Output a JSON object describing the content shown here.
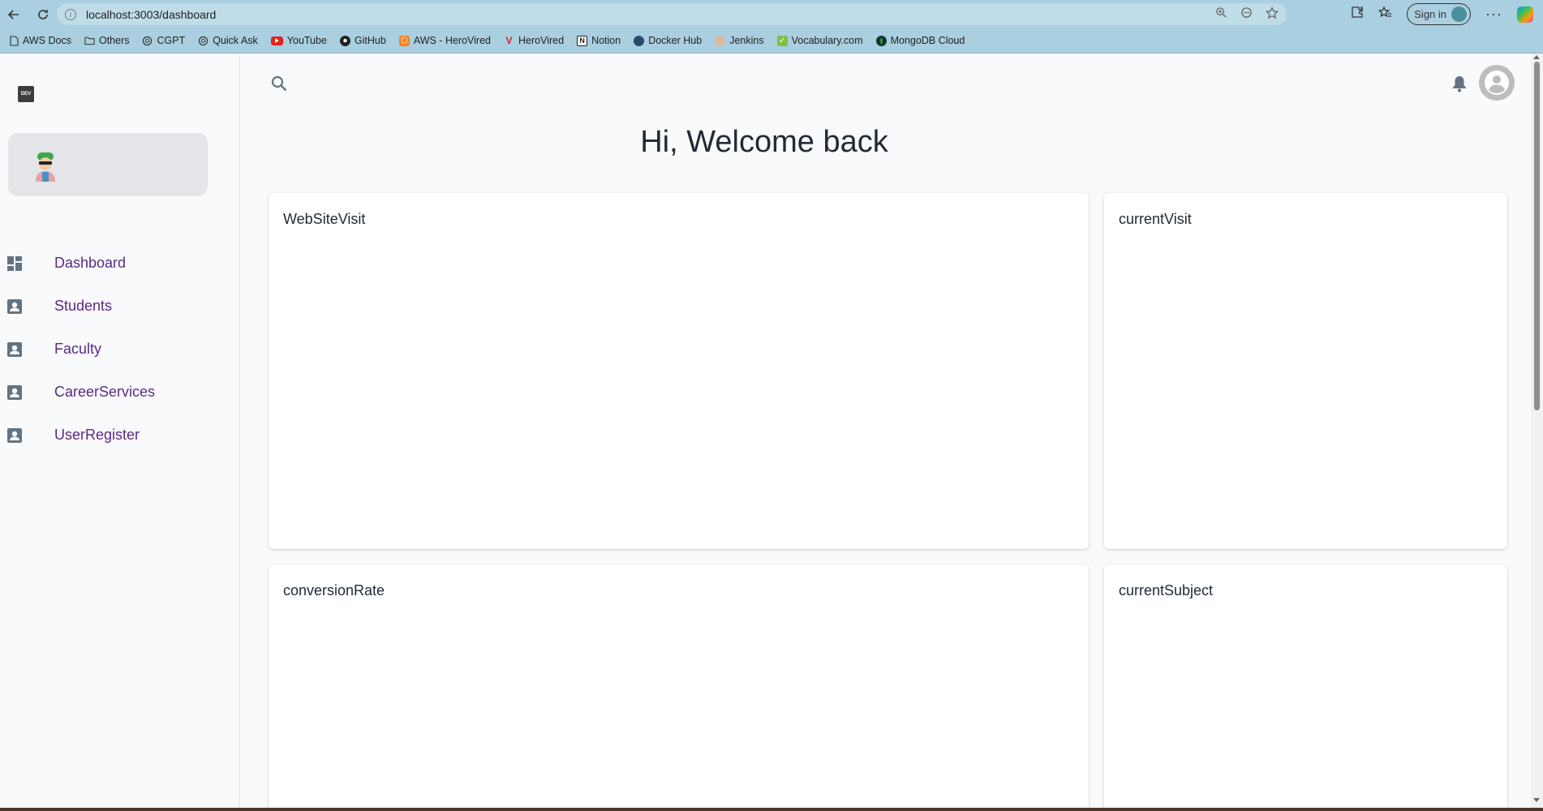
{
  "browser": {
    "url": "localhost:3003/dashboard",
    "signin_label": "Sign in",
    "bookmarks": [
      {
        "label": "AWS Docs",
        "icon": "doc-icon"
      },
      {
        "label": "Others",
        "icon": "folder-icon"
      },
      {
        "label": "CGPT",
        "icon": "chatgpt-icon"
      },
      {
        "label": "Quick Ask",
        "icon": "chatgpt-icon"
      },
      {
        "label": "YouTube",
        "icon": "youtube-icon"
      },
      {
        "label": "GitHub",
        "icon": "github-icon"
      },
      {
        "label": "AWS - HeroVired",
        "icon": "aws-icon"
      },
      {
        "label": "HeroVired",
        "icon": "herovired-icon"
      },
      {
        "label": "Notion",
        "icon": "notion-icon"
      },
      {
        "label": "Docker Hub",
        "icon": "docker-icon"
      },
      {
        "label": "Jenkins",
        "icon": "jenkins-icon"
      },
      {
        "label": "Vocabulary.com",
        "icon": "vocabulary-icon"
      },
      {
        "label": "MongoDB Cloud",
        "icon": "mongodb-icon"
      }
    ]
  },
  "sidebar": {
    "logo_text": "DEV",
    "nav": [
      {
        "label": "Dashboard",
        "icon": "dashboard-icon"
      },
      {
        "label": "Students",
        "icon": "contact-icon"
      },
      {
        "label": "Faculty",
        "icon": "contact-icon"
      },
      {
        "label": "CareerServices",
        "icon": "contact-icon"
      },
      {
        "label": "UserRegister",
        "icon": "contact-icon"
      }
    ],
    "accent": "#5b2a86"
  },
  "main": {
    "welcome": "Hi, Welcome back",
    "cards": [
      {
        "title": "WebSiteVisit"
      },
      {
        "title": "currentVisit"
      },
      {
        "title": "conversionRate"
      },
      {
        "title": "currentSubject"
      }
    ]
  }
}
